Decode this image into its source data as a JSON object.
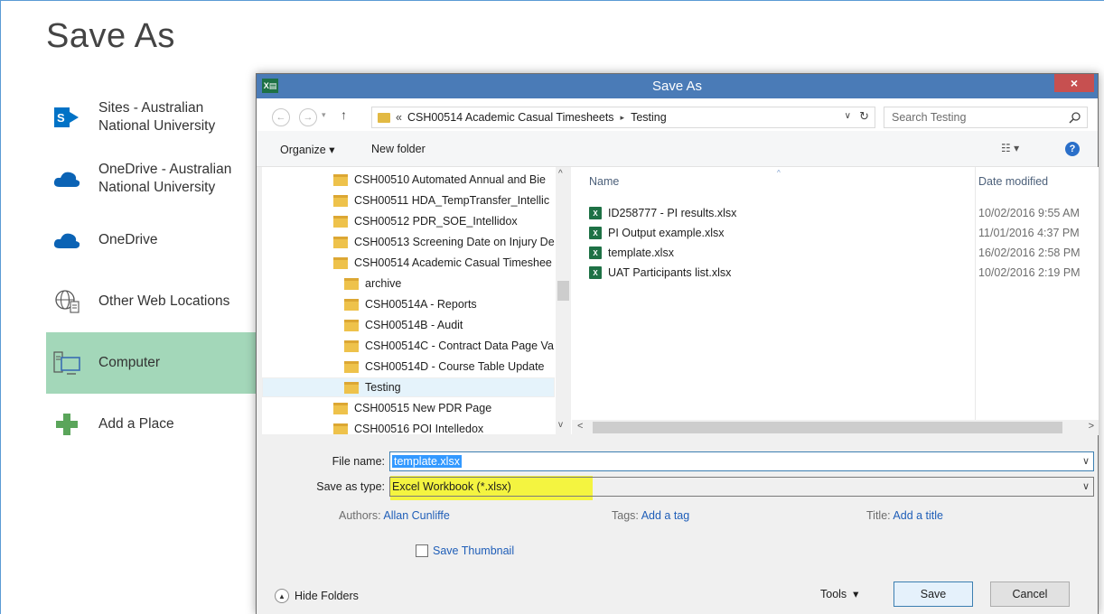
{
  "backstage": {
    "title": "Save As",
    "places": [
      {
        "label": "Sites - Australian National University",
        "icon": "sharepoint-icon"
      },
      {
        "label": "OneDrive - Australian National University",
        "icon": "onedrive-icon"
      },
      {
        "label": "OneDrive",
        "icon": "onedrive-icon"
      },
      {
        "label": "Other Web Locations",
        "icon": "globe-icon"
      },
      {
        "label": "Computer",
        "icon": "computer-icon"
      },
      {
        "label": "Add a Place",
        "icon": "plus-icon"
      }
    ]
  },
  "dialog": {
    "title": "Save As",
    "close": "×",
    "address": {
      "prefix": "«",
      "path": [
        "CSH00514 Academic Casual Timesheets",
        "Testing"
      ],
      "separator": "▸"
    },
    "search": {
      "placeholder": "Search Testing"
    },
    "toolbar": {
      "organize": "Organize ▾",
      "new_folder": "New folder"
    },
    "tree": [
      {
        "label": "CSH00510 Automated Annual and Bie",
        "indent": 0
      },
      {
        "label": "CSH00511 HDA_TempTransfer_Intellic",
        "indent": 0
      },
      {
        "label": "CSH00512 PDR_SOE_Intellidox",
        "indent": 0
      },
      {
        "label": "CSH00513 Screening Date on Injury De",
        "indent": 0
      },
      {
        "label": "CSH00514 Academic Casual Timeshee",
        "indent": 0
      },
      {
        "label": "archive",
        "indent": 1
      },
      {
        "label": "CSH00514A - Reports",
        "indent": 1
      },
      {
        "label": "CSH00514B - Audit",
        "indent": 1
      },
      {
        "label": "CSH00514C - Contract Data Page Va",
        "indent": 1
      },
      {
        "label": "CSH00514D - Course Table Update",
        "indent": 1
      },
      {
        "label": "Testing",
        "indent": 1
      },
      {
        "label": "CSH00515 New PDR Page",
        "indent": 0
      },
      {
        "label": "CSH00516 POI Intelledox",
        "indent": 0
      }
    ],
    "columns": {
      "name": "Name",
      "date": "Date modified"
    },
    "files": [
      {
        "name": "ID258777 - PI results.xlsx",
        "date": "10/02/2016 9:55 AM"
      },
      {
        "name": "PI Output example.xlsx",
        "date": "11/01/2016 4:37 PM"
      },
      {
        "name": "template.xlsx",
        "date": "16/02/2016 2:58 PM"
      },
      {
        "name": "UAT Participants list.xlsx",
        "date": "10/02/2016 2:19 PM"
      }
    ],
    "form": {
      "file_name_label": "File name:",
      "file_name_value": "template.xlsx",
      "save_type_label": "Save as type:",
      "save_type_value": "Excel Workbook (*.xlsx)",
      "authors_label": "Authors:",
      "authors_value": "Allan Cunliffe",
      "tags_label": "Tags:",
      "tags_value": "Add a tag",
      "title_label": "Title:",
      "title_value": "Add a title",
      "thumbnail_label": "Save Thumbnail"
    },
    "buttons": {
      "hide_folders": "Hide Folders",
      "tools": "Tools",
      "save": "Save",
      "cancel": "Cancel"
    }
  }
}
